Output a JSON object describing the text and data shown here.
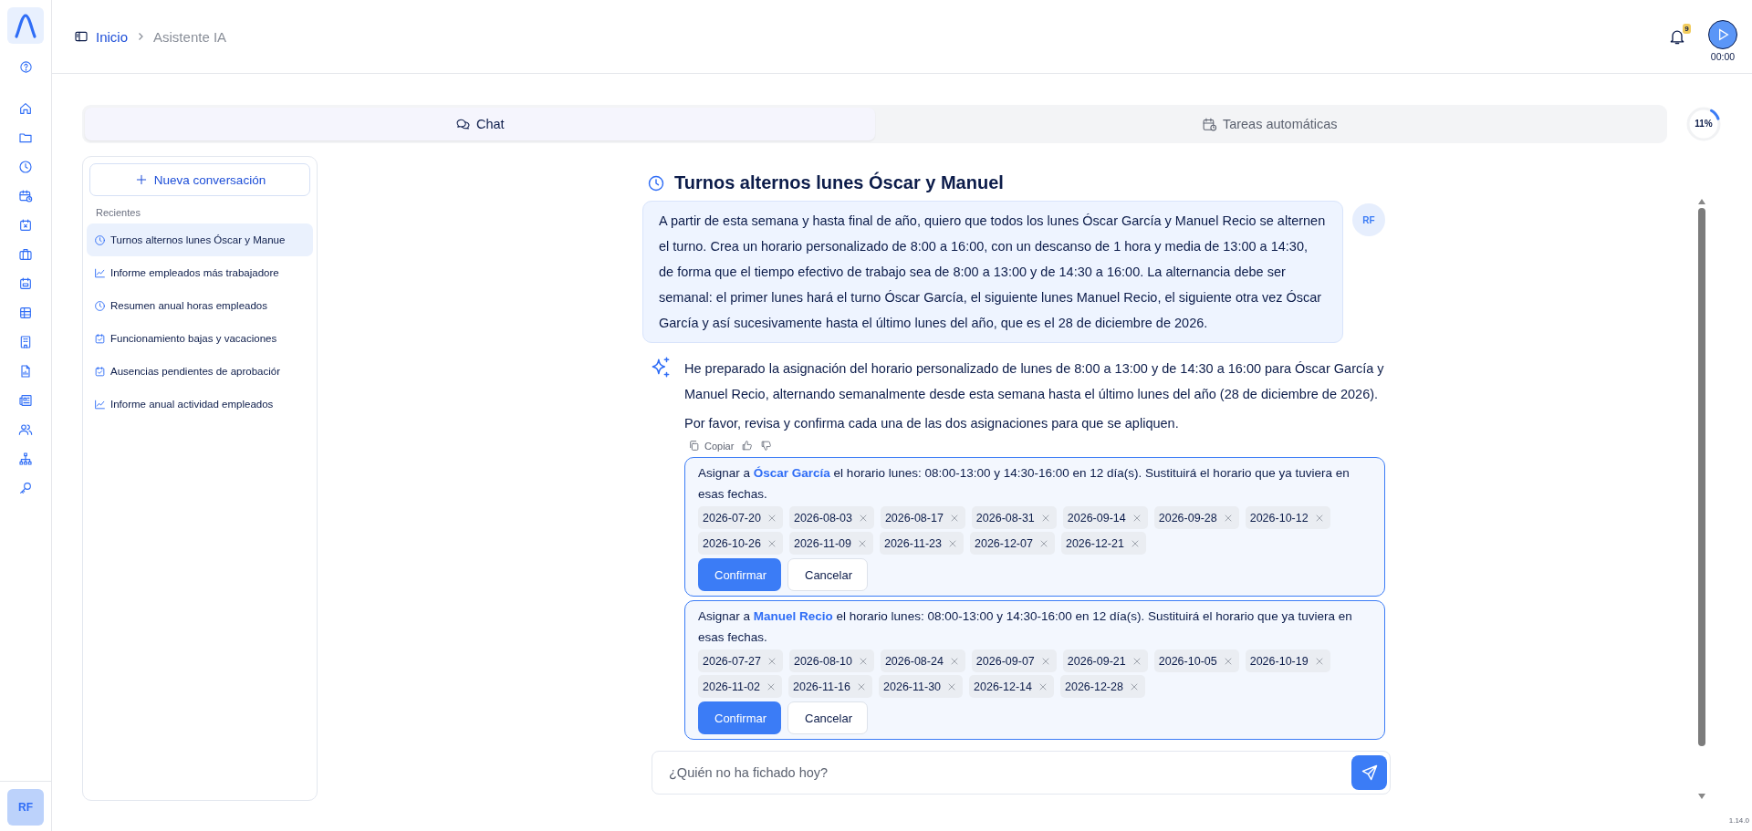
{
  "user_avatar": "RF",
  "breadcrumb": [
    {
      "label": "Inicio",
      "kind": "link"
    },
    {
      "label": "Asistente IA",
      "kind": "current"
    }
  ],
  "notifications": {
    "count": "9"
  },
  "timer": "00:00",
  "tabs": [
    {
      "label": "Chat",
      "kind": "chat",
      "selected": true
    },
    {
      "label": "Tareas automáticas",
      "kind": "tasks",
      "selected": false
    }
  ],
  "usage": {
    "level": 0.11,
    "reading": "11%"
  },
  "sidebar": {
    "new_button": "Nueva conversación",
    "section": "Recientes",
    "items": [
      {
        "label": "Turnos alternos lunes Óscar y Manue",
        "kind": "clock",
        "selected": true
      },
      {
        "label": "Informe empleados más trabajadore",
        "kind": "chart",
        "selected": false
      },
      {
        "label": "Resumen anual horas empleados",
        "kind": "clock",
        "selected": false
      },
      {
        "label": "Funcionamiento bajas y vacaciones",
        "kind": "check",
        "selected": false
      },
      {
        "label": "Ausencias pendientes de aprobaciór",
        "kind": "check",
        "selected": false
      },
      {
        "label": "Informe anual actividad empleados",
        "kind": "chart",
        "selected": false
      }
    ]
  },
  "chat": {
    "title": "Turnos alternos lunes Óscar y Manuel",
    "user_message": {
      "avatar": "RF",
      "text": "A partir de esta semana y hasta final de año, quiero que todos los lunes Óscar García y Manuel Recio se alternen el turno. Crea un horario personalizado de 8:00 a 16:00, con un descanso de 1 hora y media de 13:00 a 14:30, de forma que el tiempo efectivo de trabajo sea de 8:00 a 13:00 y de 14:30 a 16:00. La alternancia debe ser semanal: el primer lunes hará el turno Óscar García, el siguiente lunes Manuel Recio, el siguiente otra vez Óscar García y así sucesivamente hasta el último lunes del año, que es el 28 de diciembre de 2026."
    },
    "assistant_message": {
      "paragraphs": [
        "He preparado la asignación del horario personalizado de lunes de 8:00 a 13:00 y de 14:30 a 16:00 para Óscar García y Manuel Recio, alternando semanalmente desde esta semana hasta el último lunes del año (28 de diciembre de 2026).",
        "Por favor, revisa y confirma cada una de las dos asignaciones para que se apliquen."
      ],
      "copy_label": "Copiar"
    },
    "cards": [
      {
        "text": "Asignar a **Óscar García** el horario lunes: 08:00-13:00 y 14:30-16:00 en 12 día(s). Sustituirá el horario que ya tuviera en esas fechas.",
        "dates": [
          "2026-07-20",
          "2026-08-03",
          "2026-08-17",
          "2026-08-31",
          "2026-09-14",
          "2026-09-28",
          "2026-10-12",
          "2026-10-26",
          "2026-11-09",
          "2026-11-23",
          "2026-12-07",
          "2026-12-21"
        ],
        "confirm": "Confirmar",
        "cancel": "Cancelar"
      },
      {
        "text": "Asignar a **Manuel Recio** el horario lunes: 08:00-13:00 y 14:30-16:00 en 12 día(s). Sustituirá el horario que ya tuviera en esas fechas.",
        "dates": [
          "2026-07-27",
          "2026-08-10",
          "2026-08-24",
          "2026-09-07",
          "2026-09-21",
          "2026-10-05",
          "2026-10-19",
          "2026-11-02",
          "2026-11-16",
          "2026-11-30",
          "2026-12-14",
          "2026-12-28"
        ],
        "confirm": "Confirmar",
        "cancel": "Cancelar"
      }
    ]
  },
  "composer": {
    "placeholder": "¿Quién no ha fichado hoy?"
  },
  "version": "1.14.0"
}
